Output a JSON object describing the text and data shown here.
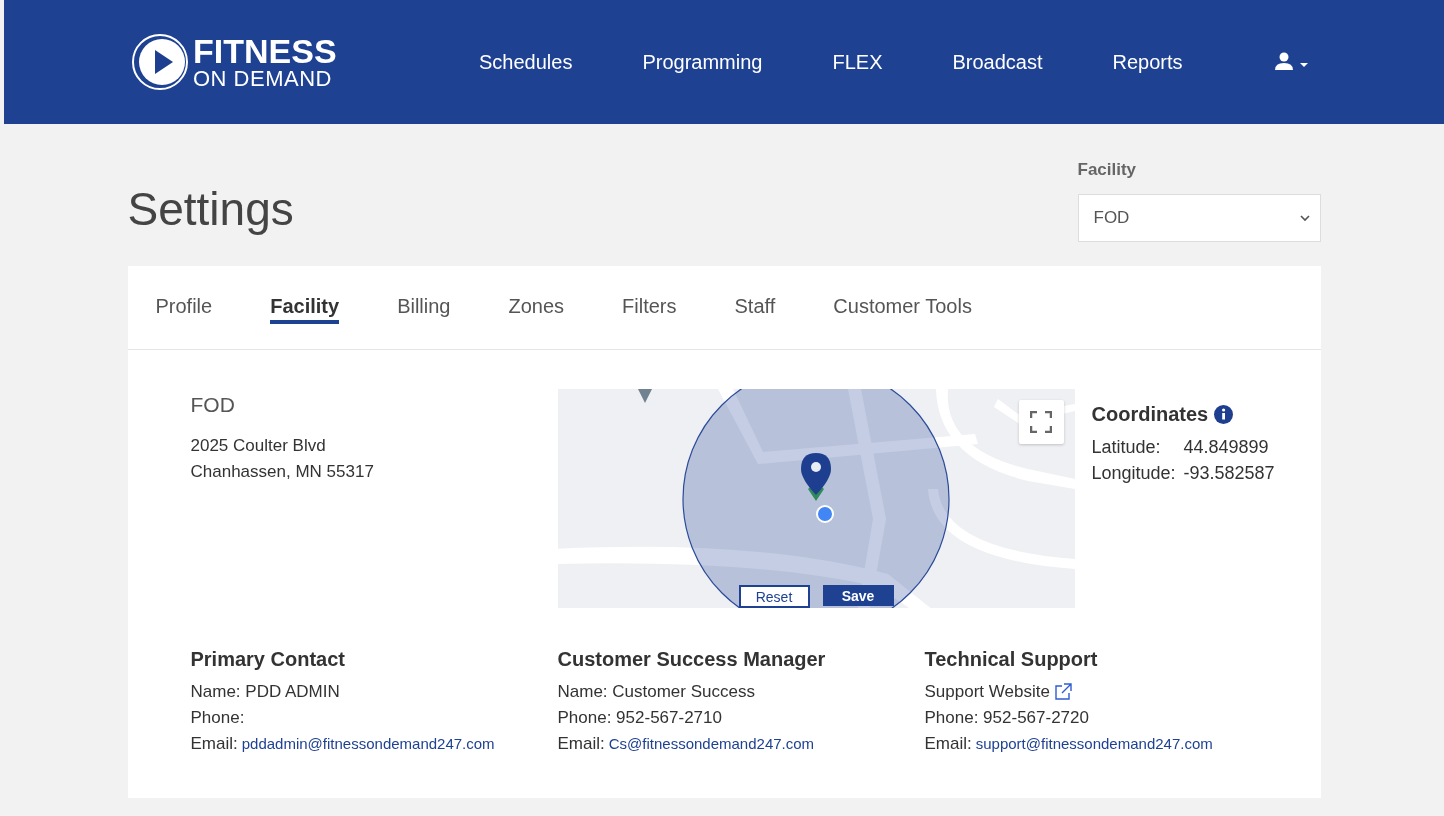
{
  "header": {
    "logo": {
      "line_1": "FITNESS",
      "line_2": "ON DEMAND"
    },
    "nav": [
      {
        "label": "Schedules"
      },
      {
        "label": "Programming"
      },
      {
        "label": "FLEX"
      },
      {
        "label": "Broadcast"
      },
      {
        "label": "Reports"
      }
    ]
  },
  "page_title": "Settings",
  "facility_select": {
    "label": "Facility",
    "value": "FOD"
  },
  "tabs": [
    {
      "label": "Profile",
      "selected": false
    },
    {
      "label": "Facility",
      "selected": true
    },
    {
      "label": "Billing",
      "selected": false
    },
    {
      "label": "Zones",
      "selected": false
    },
    {
      "label": "Filters",
      "selected": false
    },
    {
      "label": "Staff",
      "selected": false
    },
    {
      "label": "Customer Tools",
      "selected": false
    }
  ],
  "facility": {
    "name": "FOD",
    "address_lines": [
      "2025 Coulter Blvd",
      "Chanhassen, MN 55317"
    ]
  },
  "map": {
    "buttons": [
      {
        "label": "Reset",
        "kind": "secondary"
      },
      {
        "label": "Save",
        "kind": "primary"
      }
    ]
  },
  "coordinates": {
    "title": "Coordinates",
    "rows": [
      {
        "label": "Latitude:",
        "value": "44.849899"
      },
      {
        "label": "Longitude:",
        "value": "-93.582587"
      }
    ]
  },
  "contacts": [
    {
      "title": "Primary Contact",
      "lines": [
        {
          "kind": "text",
          "text": "Name: PDD ADMIN"
        },
        {
          "kind": "text",
          "text": "Phone:"
        },
        {
          "kind": "email",
          "label": "Email:",
          "value": "pddadmin@fitnessondemand247.com"
        }
      ]
    },
    {
      "title": "Customer Success Manager",
      "lines": [
        {
          "kind": "text",
          "text": "Name: Customer Success"
        },
        {
          "kind": "text",
          "text": "Phone: 952-567-2710"
        },
        {
          "kind": "email",
          "label": "Email:",
          "value": "Cs@fitnessondemand247.com"
        }
      ]
    },
    {
      "title": "Technical Support",
      "lines": [
        {
          "kind": "external",
          "text": "Support Website"
        },
        {
          "kind": "text",
          "text": "Phone: 952-567-2720"
        },
        {
          "kind": "email",
          "label": "Email:",
          "value": "support@fitnessondemand247.com"
        }
      ]
    }
  ]
}
